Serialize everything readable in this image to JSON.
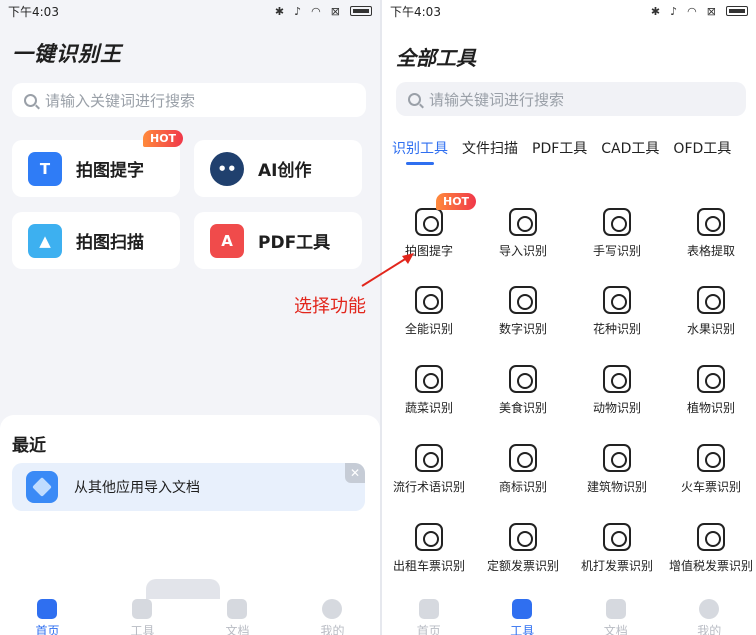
{
  "left": {
    "status": {
      "time": "下午4:03"
    },
    "app_title": "一键识别王",
    "search": {
      "placeholder": "请输入关键词进行搜索"
    },
    "cards": [
      {
        "label": "拍图提字",
        "icon": "text-scan-icon",
        "badge": "HOT",
        "color": "#2f7cf6"
      },
      {
        "label": "AI创作",
        "icon": "robot-icon",
        "badge": "",
        "color": "#20406e"
      },
      {
        "label": "拍图扫描",
        "icon": "image-scan-icon",
        "badge": "",
        "color": "#3db0f0"
      },
      {
        "label": "PDF工具",
        "icon": "pdf-icon",
        "badge": "",
        "color": "#f04b4b"
      }
    ],
    "recent": {
      "title": "最近",
      "item_label": "从其他应用导入文档",
      "close": "✕"
    },
    "tabbar": [
      {
        "label": "首页",
        "active": true
      },
      {
        "label": "工具",
        "active": false
      },
      {
        "label": "文档",
        "active": false
      },
      {
        "label": "我的",
        "active": false
      }
    ]
  },
  "right": {
    "status": {
      "time": "下午4:03"
    },
    "page_title": "全部工具",
    "search": {
      "placeholder": "请输关键词进行搜索"
    },
    "category_tabs": [
      "识别工具",
      "文件扫描",
      "PDF工具",
      "CAD工具",
      "OFD工具"
    ],
    "active_tab": "识别工具",
    "tools": [
      "拍图提字",
      "导入识别",
      "手写识别",
      "表格提取",
      "全能识别",
      "数字识别",
      "花种识别",
      "水果识别",
      "蔬菜识别",
      "美食识别",
      "动物识别",
      "植物识别",
      "流行术语识别",
      "商标识别",
      "建筑物识别",
      "火车票识别",
      "出租车票识别",
      "定额发票识别",
      "机打发票识别",
      "增值税发票识别"
    ],
    "hot_badge": "HOT",
    "tabbar": [
      {
        "label": "首页",
        "active": false
      },
      {
        "label": "工具",
        "active": true
      },
      {
        "label": "文档",
        "active": false
      },
      {
        "label": "我的",
        "active": false
      }
    ]
  },
  "annotation": {
    "text": "选择功能",
    "color": "#e2261c"
  },
  "colors": {
    "accent": "#2f6ff0",
    "hot": "#f0384a"
  }
}
